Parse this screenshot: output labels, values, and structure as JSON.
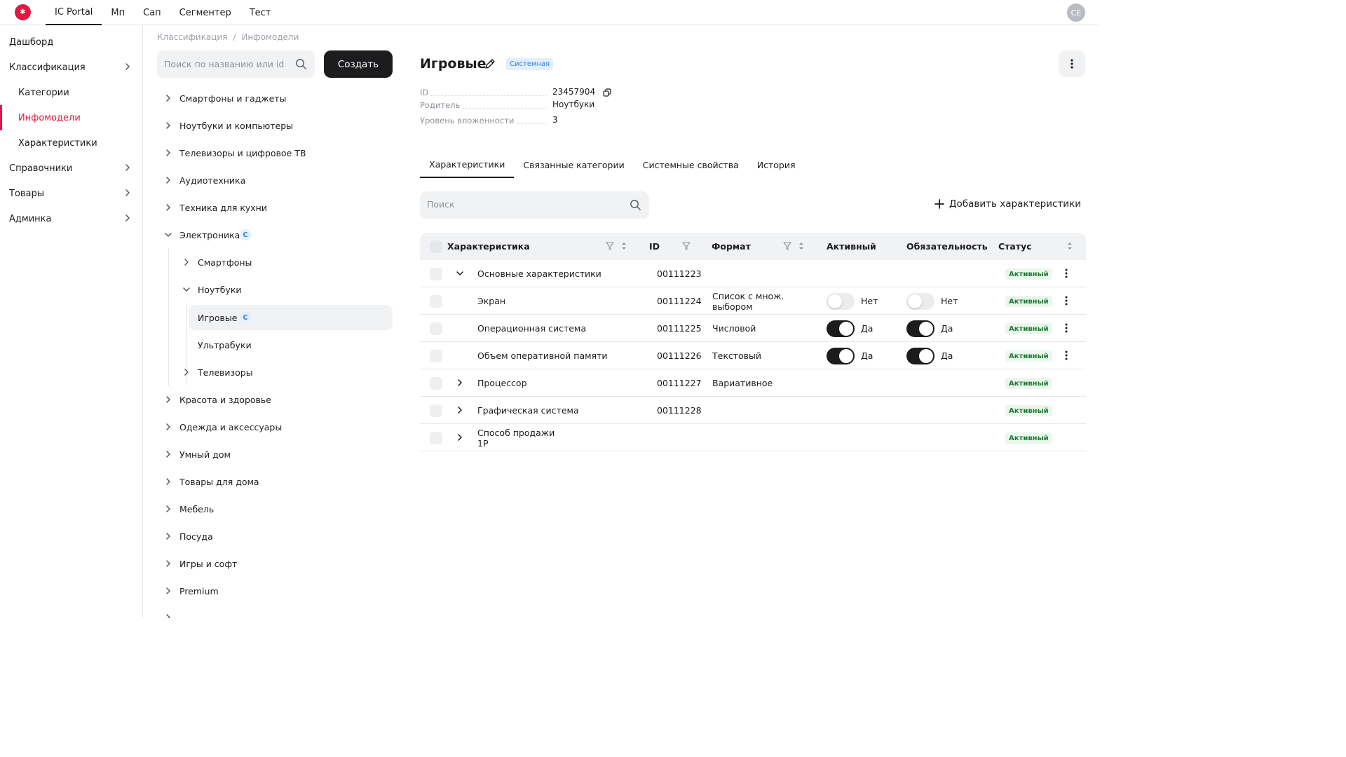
{
  "topbar": {
    "logo_glyph": "✱",
    "nav": [
      "IC Portal",
      "Мп",
      "Сап",
      "Сегментер",
      "Тест"
    ],
    "avatar": "CE"
  },
  "sidebar": {
    "items": [
      {
        "label": "Дашборд"
      },
      {
        "label": "Классификация"
      },
      {
        "label": "Категории"
      },
      {
        "label": "Инфомодели"
      },
      {
        "label": "Характеристики"
      },
      {
        "label": "Справочники"
      },
      {
        "label": "Товары"
      },
      {
        "label": "Админка"
      }
    ]
  },
  "middle": {
    "breadcrumb": [
      "Классификация",
      "/",
      "Инфомодели"
    ],
    "search_placeholder": "Поиск по названию или id",
    "create_label": "Создать",
    "tree": [
      {
        "label": "Смартфоны и гаджеты"
      },
      {
        "label": "Ноутбуки и компьютеры"
      },
      {
        "label": "Телевизоры и цифровое ТВ"
      },
      {
        "label": "Аудиотехника"
      },
      {
        "label": "Техника для кухни"
      },
      {
        "label": "Электроника",
        "badge": "C"
      },
      {
        "label": "Смартфоны"
      },
      {
        "label": "Ноутбуки"
      },
      {
        "label": "Игровые",
        "badge": "C"
      },
      {
        "label": "Ультрабуки"
      },
      {
        "label": "Телевизоры"
      },
      {
        "label": "Красота и здоровье"
      },
      {
        "label": "Одежда и аксессуары"
      },
      {
        "label": "Умный дом"
      },
      {
        "label": "Товары для дома"
      },
      {
        "label": "Мебель"
      },
      {
        "label": "Посуда"
      },
      {
        "label": "Игры и софт"
      },
      {
        "label": "Premium"
      }
    ]
  },
  "main": {
    "title": "Игровые",
    "system_badge": "Системная",
    "meta": {
      "id_label": "ID",
      "id_value": "23457904",
      "parent_label": "Родитель",
      "parent_value": "Ноутбуки",
      "level_label": "Уровень вложенности",
      "level_value": "3"
    },
    "tabs": [
      "Характеристики",
      "Связанные категории",
      "Системные свойства",
      "История"
    ],
    "search_placeholder": "Поиск",
    "add_label": "Добавить характеристики",
    "table": {
      "headers": {
        "name": "Характеристика",
        "id": "ID",
        "format": "Формат",
        "active": "Активный",
        "required": "Обязательность",
        "status": "Статус"
      },
      "rows": [
        {
          "name": "Основные характеристики",
          "id": "00111223",
          "format": "",
          "active": null,
          "active_label": "",
          "required": null,
          "required_label": "",
          "status": "Активный",
          "expand": "down",
          "indent": false,
          "menu": true
        },
        {
          "name": "Экран",
          "id": "00111224",
          "format": "Список с множ.",
          "format2": "выбором",
          "active": false,
          "active_label": "Нет",
          "required": false,
          "required_label": "Нет",
          "status": "Активный",
          "expand": null,
          "indent": true,
          "menu": true
        },
        {
          "name": "Операционная система",
          "id": "00111225",
          "format": "Числовой",
          "active": true,
          "active_label": "Да",
          "required": true,
          "required_label": "Да",
          "status": "Активный",
          "expand": null,
          "indent": true,
          "menu": true
        },
        {
          "name": "Объем оперативной памяти",
          "id": "00111226",
          "format": "Текстовый",
          "active": true,
          "active_label": "Да",
          "required": true,
          "required_label": "Да",
          "status": "Активный",
          "expand": null,
          "indent": true,
          "menu": true
        },
        {
          "name": "Процессор",
          "id": "00111227",
          "format": "Вариативное",
          "active": null,
          "active_label": "",
          "required": null,
          "required_label": "",
          "status": "Активный",
          "expand": "right",
          "indent": false,
          "menu": false
        },
        {
          "name": "Графическая система",
          "id": "00111228",
          "format": "",
          "active": null,
          "active_label": "",
          "required": null,
          "required_label": "",
          "status": "Активный",
          "expand": "right",
          "indent": false,
          "menu": false
        },
        {
          "name": "Способ продажи",
          "name2": "1P",
          "id": "",
          "format": "",
          "active": null,
          "active_label": "",
          "required": null,
          "required_label": "",
          "status": "Активный",
          "expand": "right",
          "indent": false,
          "menu": false
        }
      ]
    }
  },
  "colors": {
    "accent": "#e5173f",
    "dark": "#1c1c1e",
    "status_bg": "#eaf7ec",
    "status_text": "#1f7a34",
    "badge_blue": "#2f7be5"
  }
}
